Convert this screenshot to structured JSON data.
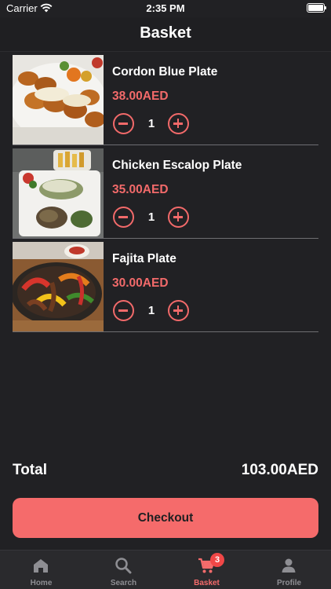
{
  "status": {
    "carrier": "Carrier",
    "time": "2:35 PM"
  },
  "header": {
    "title": "Basket"
  },
  "basket": {
    "items": [
      {
        "name": "Cordon Blue Plate",
        "price": "38.00AED",
        "qty": "1"
      },
      {
        "name": "Chicken Escalop Plate",
        "price": "35.00AED",
        "qty": "1"
      },
      {
        "name": "Fajita Plate",
        "price": "30.00AED",
        "qty": "1"
      }
    ]
  },
  "summary": {
    "total_label": "Total",
    "total_value": "103.00AED"
  },
  "actions": {
    "checkout_label": "Checkout"
  },
  "tabs": {
    "items": [
      {
        "label": "Home",
        "icon": "home-icon"
      },
      {
        "label": "Search",
        "icon": "search-icon"
      },
      {
        "label": "Basket",
        "icon": "cart-icon",
        "badge": "3",
        "active": true
      },
      {
        "label": "Profile",
        "icon": "person-icon"
      }
    ]
  },
  "colors": {
    "accent": "#f56b6b",
    "background": "#212124",
    "tabbar": "#2a2a2d"
  }
}
